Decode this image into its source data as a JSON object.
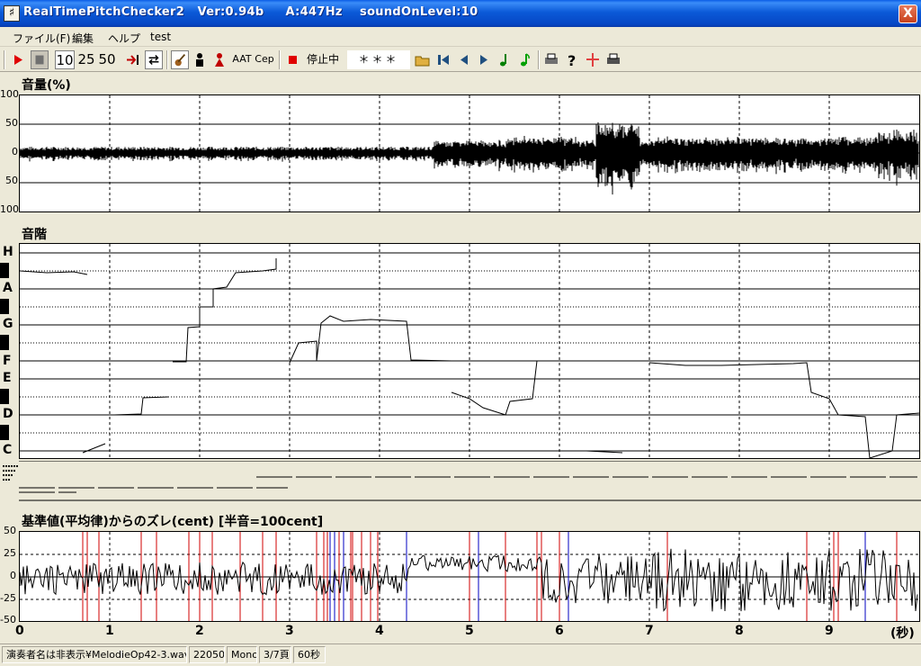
{
  "window": {
    "title": "RealTimePitchChecker2   Ver:0.94b     A:447Hz    soundOnLevel:10",
    "app_icon": "♯",
    "close_label": "X"
  },
  "menu": [
    "ファイル(F)",
    "編集",
    "ヘルプ",
    "test"
  ],
  "toolbar": {
    "speed_10": "10",
    "speed_25": "25",
    "speed_50": "50",
    "text_aat": "AAT",
    "text_cep": "Cep",
    "status": "停止中",
    "note_display": "＊＊＊",
    "icons": [
      "play-icon",
      "stop-icon",
      "jump-end-icon",
      "loop-icon",
      "violin-icon",
      "player-icon",
      "player-red-icon",
      "record-stop-icon",
      "open-folder-icon",
      "skip-first-icon",
      "step-back-icon",
      "step-forward-icon",
      "note-green-icon",
      "note-green2-icon",
      "print-icon",
      "help-icon",
      "cursor-icon",
      "print2-icon"
    ]
  },
  "volume_panel": {
    "title": "音量(%)",
    "y_ticks": [
      "100",
      "50",
      "0",
      "50",
      "100"
    ]
  },
  "pitch_panel": {
    "title": "音階",
    "notes": [
      "H",
      "A",
      "G",
      "F",
      "E",
      "D",
      "C"
    ]
  },
  "cent_panel": {
    "title": "基準値(平均律)からのズレ(cent) [半音=100cent]",
    "y_ticks": [
      "50",
      "25",
      "0",
      "-25",
      "-50"
    ]
  },
  "x_axis": {
    "ticks": [
      "0",
      "1",
      "2",
      "3",
      "4",
      "5",
      "6",
      "7",
      "8",
      "9"
    ],
    "unit": "(秒)"
  },
  "statusbar": {
    "file": "演奏者名は非表示¥MelodieOp42-3.wav",
    "rate": "22050",
    "channels": "Mono",
    "page": "3/7頁",
    "duration": "60秒"
  },
  "colors": {
    "grid": "#000000",
    "red_marker": "#d00000",
    "blue_marker": "#0000c0"
  }
}
